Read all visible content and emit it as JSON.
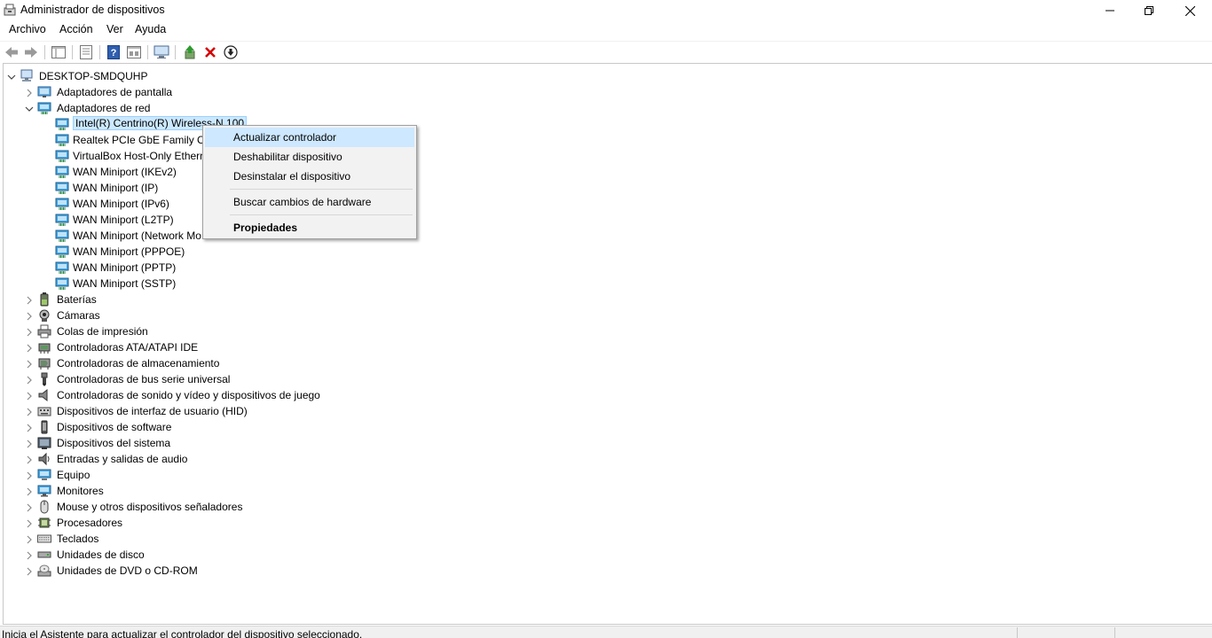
{
  "window": {
    "title": "Administrador de dispositivos"
  },
  "menu": [
    "Archivo",
    "Acción",
    "Ver",
    "Ayuda"
  ],
  "toolbar": {
    "buttons": [
      "back-icon",
      "forward-icon",
      "properties-icon",
      "details-icon",
      "help-icon",
      "view-icon",
      "monitor-icon",
      "update-driver-icon",
      "uninstall-icon",
      "download-icon"
    ]
  },
  "tree": {
    "root": "DESKTOP-SMDQUHP",
    "categories": [
      {
        "label": "Adaptadores de pantalla",
        "icon": "display-adapter-icon",
        "expanded": false
      },
      {
        "label": "Adaptadores de red",
        "icon": "network-adapter-icon",
        "expanded": true,
        "children": [
          "Intel(R) Centrino(R) Wireless-N 100",
          "Realtek PCIe GbE Family Co",
          "VirtualBox Host-Only Ethern",
          "WAN Miniport (IKEv2)",
          "WAN Miniport (IP)",
          "WAN Miniport (IPv6)",
          "WAN Miniport (L2TP)",
          "WAN Miniport (Network Mo",
          "WAN Miniport (PPPOE)",
          "WAN Miniport (PPTP)",
          "WAN Miniport (SSTP)"
        ]
      },
      {
        "label": "Baterías",
        "icon": "battery-icon",
        "expanded": false
      },
      {
        "label": "Cámaras",
        "icon": "camera-icon",
        "expanded": false
      },
      {
        "label": "Colas de impresión",
        "icon": "printer-icon",
        "expanded": false
      },
      {
        "label": "Controladoras ATA/ATAPI IDE",
        "icon": "ide-controller-icon",
        "expanded": false
      },
      {
        "label": "Controladoras de almacenamiento",
        "icon": "storage-controller-icon",
        "expanded": false
      },
      {
        "label": "Controladoras de bus serie universal",
        "icon": "usb-icon",
        "expanded": false
      },
      {
        "label": "Controladoras de sonido y vídeo y dispositivos de juego",
        "icon": "speaker-icon",
        "expanded": false
      },
      {
        "label": "Dispositivos de interfaz de usuario (HID)",
        "icon": "hid-icon",
        "expanded": false
      },
      {
        "label": "Dispositivos de software",
        "icon": "software-device-icon",
        "expanded": false
      },
      {
        "label": "Dispositivos del sistema",
        "icon": "system-device-icon",
        "expanded": false
      },
      {
        "label": "Entradas y salidas de audio",
        "icon": "audio-io-icon",
        "expanded": false
      },
      {
        "label": "Equipo",
        "icon": "computer-icon",
        "expanded": false
      },
      {
        "label": "Monitores",
        "icon": "monitor-icon",
        "expanded": false
      },
      {
        "label": "Mouse y otros dispositivos señaladores",
        "icon": "mouse-icon",
        "expanded": false
      },
      {
        "label": "Procesadores",
        "icon": "processor-icon",
        "expanded": false
      },
      {
        "label": "Teclados",
        "icon": "keyboard-icon",
        "expanded": false
      },
      {
        "label": "Unidades de disco",
        "icon": "disk-drive-icon",
        "expanded": false
      },
      {
        "label": "Unidades de DVD o CD-ROM",
        "icon": "dvd-drive-icon",
        "expanded": false
      }
    ]
  },
  "context_menu": {
    "items": [
      {
        "label": "Actualizar controlador",
        "highlighted": true
      },
      {
        "label": "Deshabilitar dispositivo"
      },
      {
        "label": "Desinstalar el dispositivo"
      },
      {
        "label": "Buscar cambios de hardware"
      },
      {
        "label": "Propiedades",
        "bold": true
      }
    ]
  },
  "status": {
    "text": "Inicia el Asistente para actualizar el controlador del dispositivo seleccionado."
  },
  "colors": {
    "selection": "#cce8ff",
    "menu_highlight": "#cde8ff",
    "uninstall_red": "#d40000"
  }
}
